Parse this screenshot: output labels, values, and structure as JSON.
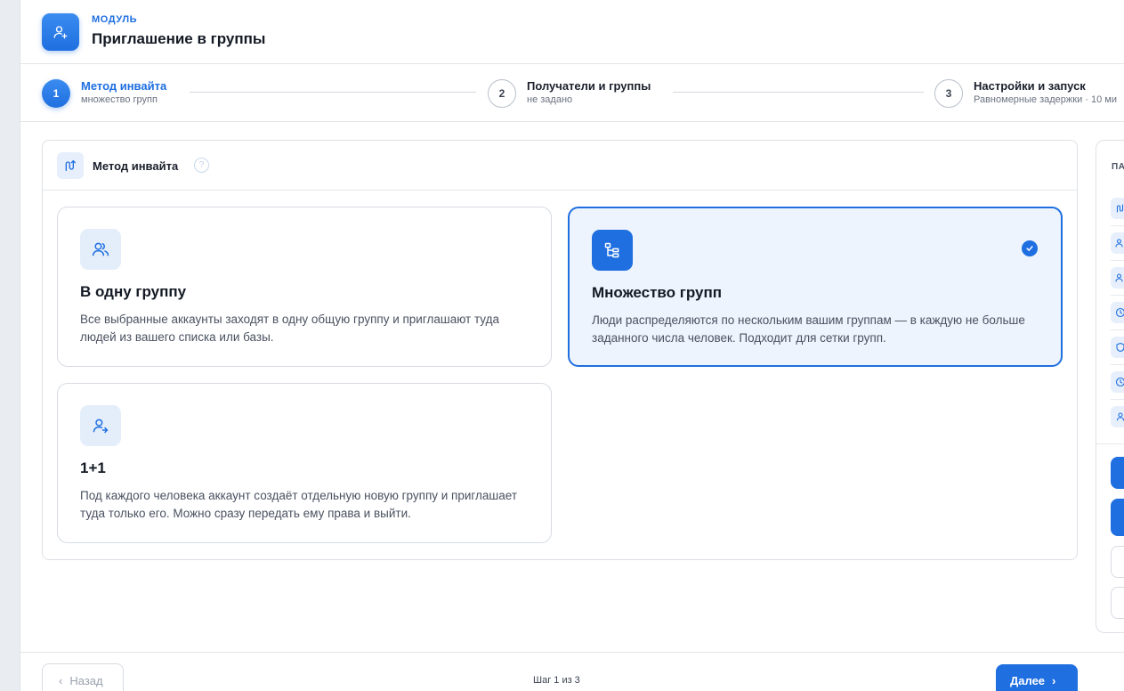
{
  "header": {
    "kicker": "МОДУЛЬ",
    "title": "Приглашение в группы",
    "icon": "user-plus-icon"
  },
  "stepper": {
    "steps": [
      {
        "number": "1",
        "title": "Метод инвайта",
        "subtitle": "множество групп",
        "state": "active"
      },
      {
        "number": "2",
        "title": "Получатели и группы",
        "subtitle": "не задано",
        "state": "idle"
      },
      {
        "number": "3",
        "title": "Настройки и запуск",
        "subtitle": "Равномерные задержки · 10 ми",
        "state": "idle"
      }
    ]
  },
  "method": {
    "title": "Метод инвайта",
    "help": "?",
    "options": [
      {
        "title": "В одну группу",
        "description": "Все выбранные аккаунты заходят в одну общую группу и приглашают туда людей из вашего списка или базы.",
        "icon": "users-icon",
        "selected": false
      },
      {
        "title": "Множество групп",
        "description": "Люди распределяются по нескольким вашим группам — в каждую не больше заданного числа человек. Подходит для сетки групп.",
        "icon": "hierarchy-icon",
        "selected": true
      },
      {
        "title": "1+1",
        "description": "Под каждого человека аккаунт создаёт отдельную новую группу и приглашает туда только его. Можно сразу передать ему права и выйти.",
        "icon": "user-arrow-icon",
        "selected": false
      }
    ]
  },
  "side_panel": {
    "label": "ПА"
  },
  "footer": {
    "back_label": "Назад",
    "step_counter": "Шаг 1 из 3",
    "next_label": "Далее"
  },
  "colors": {
    "accent": "#1f6fe0",
    "selected_bg": "#eef4fd",
    "icon_bg": "#e4eefb"
  }
}
